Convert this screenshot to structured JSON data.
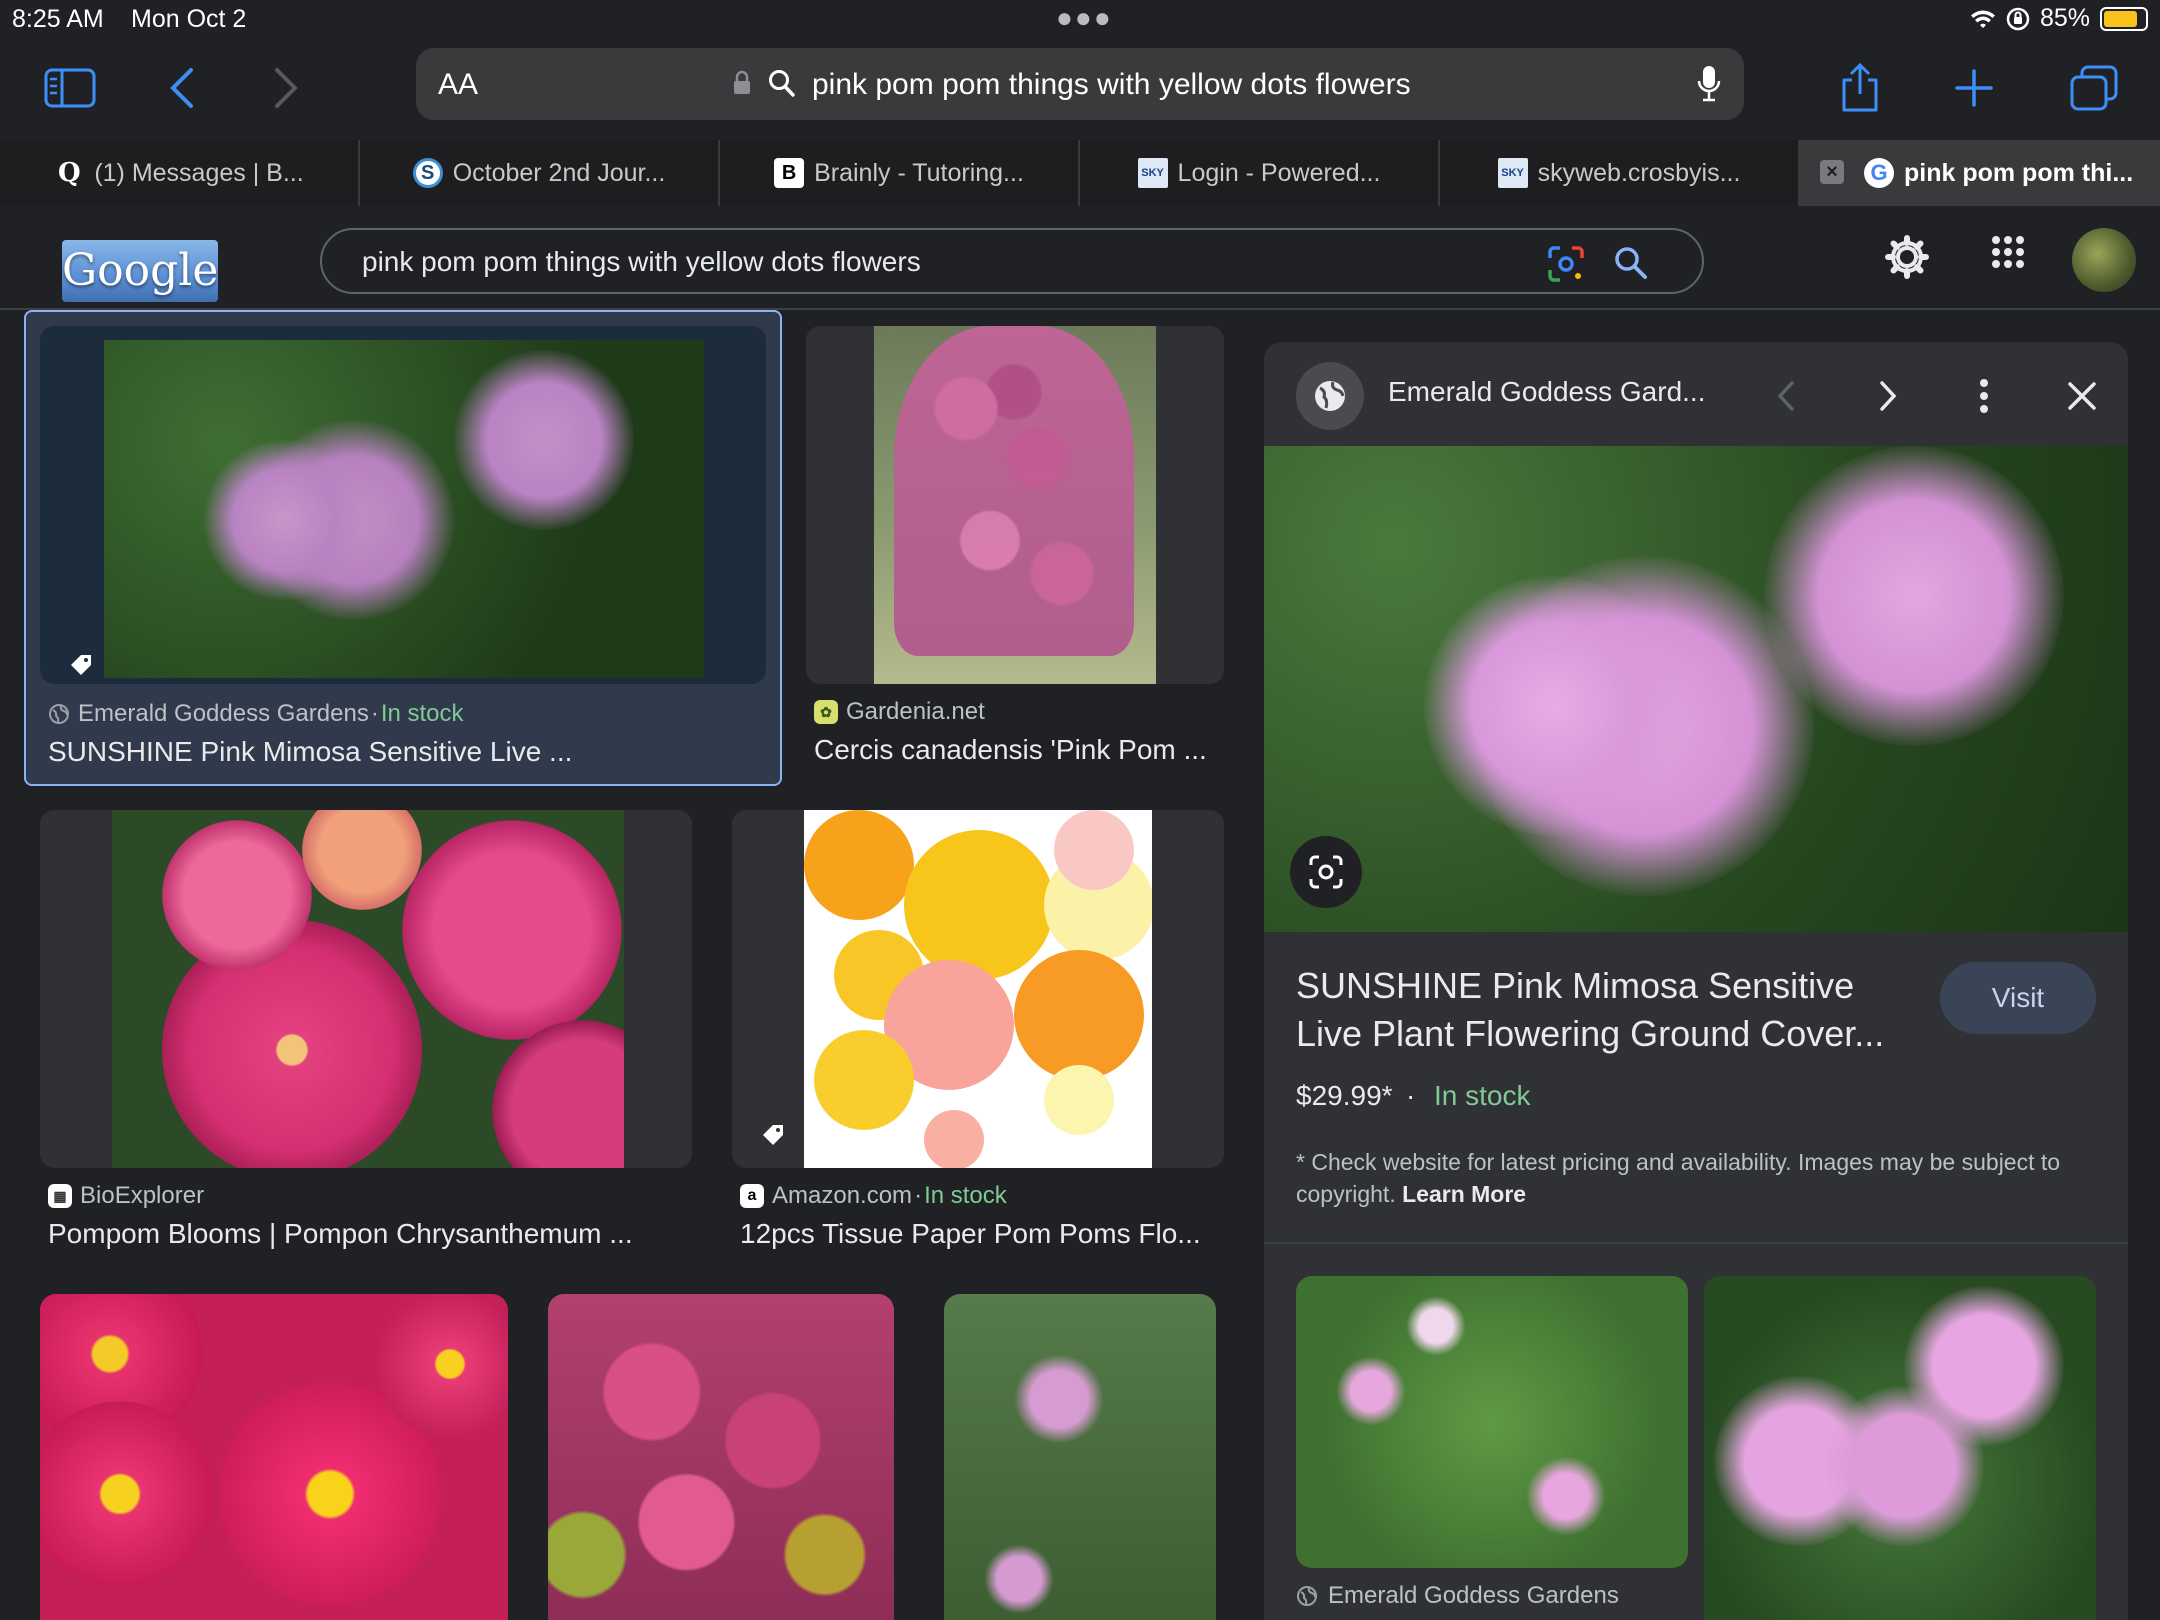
{
  "status": {
    "time": "8:25 AM",
    "date": "Mon Oct 2",
    "battery": "85%",
    "battery_level": 0.85
  },
  "browser": {
    "aa_label": "AA",
    "url_text": "pink pom pom things with yellow dots flowers",
    "tabs": [
      {
        "label": "(1) Messages | B...",
        "icon": "quora-icon",
        "icon_glyph": "Q"
      },
      {
        "label": "October 2nd Jour...",
        "icon": "s-circle-icon",
        "icon_glyph": "S"
      },
      {
        "label": "Brainly - Tutoring...",
        "icon": "brainly-icon",
        "icon_glyph": "B"
      },
      {
        "label": "Login - Powered...",
        "icon": "sky-icon",
        "icon_glyph": "SKY"
      },
      {
        "label": "skyweb.crosbyis...",
        "icon": "sky-icon",
        "icon_glyph": "SKY"
      },
      {
        "label": "pink pom pom thi...",
        "icon": "google-icon",
        "icon_glyph": "G",
        "active": true
      }
    ]
  },
  "google": {
    "logo_text": "Google",
    "query": "pink pom pom things with yellow dots flowers"
  },
  "results": [
    {
      "source": "Emerald Goddess Gardens",
      "stock": "In stock",
      "title": "SUNSHINE Pink Mimosa Sensitive Live ..."
    },
    {
      "source": "Gardenia.net",
      "stock": "",
      "title": "Cercis canadensis 'Pink Pom ..."
    },
    {
      "source": "BioExplorer",
      "stock": "",
      "title": "Pompom Blooms | Pompon Chrysanthemum ..."
    },
    {
      "source": "Amazon.com",
      "stock": "In stock",
      "title": "12pcs Tissue Paper Pom Poms Flo..."
    }
  ],
  "stock_separator": " · ",
  "panel": {
    "site": "Emerald Goddess Gard...",
    "title": "SUNSHINE Pink Mimosa Sensitive Live Plant Flowering Ground Cover...",
    "visit_label": "Visit",
    "price": "$29.99*",
    "separator": "·",
    "stock": "In stock",
    "disclaimer": "* Check website for latest pricing and availability. Images may be subject to copyright.",
    "learn_more": "Learn More",
    "related_source": "Emerald Goddess Gardens"
  },
  "colors": {
    "background": "#202124",
    "in_stock": "#81c995",
    "battery": "#f8c21c",
    "visit_button": "#394457"
  }
}
